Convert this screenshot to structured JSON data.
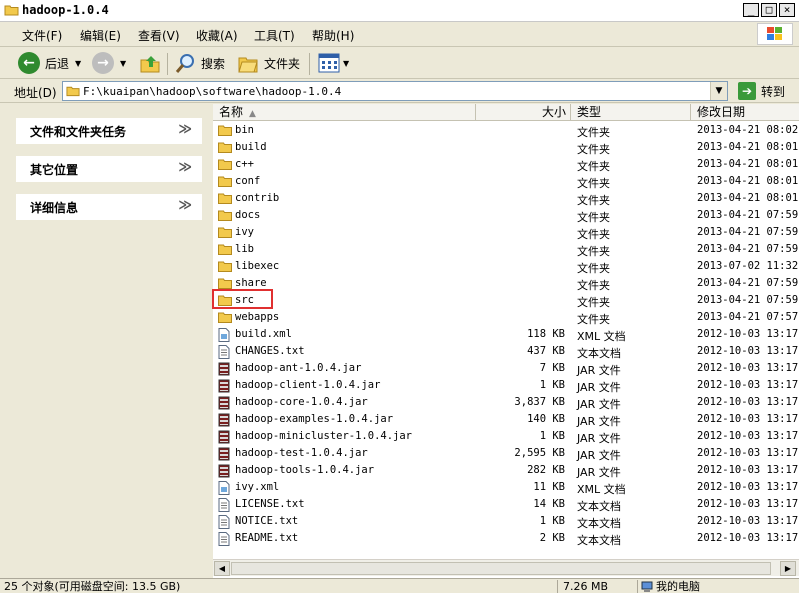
{
  "window": {
    "title": "hadoop-1.0.4",
    "buttons": [
      "_",
      "□",
      "×"
    ]
  },
  "menu": [
    "文件(F)",
    "编辑(E)",
    "查看(V)",
    "收藏(A)",
    "工具(T)",
    "帮助(H)"
  ],
  "toolbar": {
    "back_label": "后退",
    "search_label": "搜索",
    "folders_label": "文件夹"
  },
  "address": {
    "label": "地址(D)",
    "value": "F:\\kuaipan\\hadoop\\software\\hadoop-1.0.4",
    "go_label": "转到"
  },
  "tasks": [
    {
      "label": "文件和文件夹任务",
      "chevron": "≫"
    },
    {
      "label": "其它位置",
      "chevron": "≫"
    },
    {
      "label": "详细信息",
      "chevron": "≫"
    }
  ],
  "columns": {
    "name": "名称",
    "size": "大小",
    "type": "类型",
    "date": "修改日期"
  },
  "files": [
    {
      "name": "bin",
      "size": "",
      "type": "文件夹",
      "date": "2013-04-21 08:02",
      "kind": "folder"
    },
    {
      "name": "build",
      "size": "",
      "type": "文件夹",
      "date": "2013-04-21 08:01",
      "kind": "folder"
    },
    {
      "name": "c++",
      "size": "",
      "type": "文件夹",
      "date": "2013-04-21 08:01",
      "kind": "folder"
    },
    {
      "name": "conf",
      "size": "",
      "type": "文件夹",
      "date": "2013-04-21 08:01",
      "kind": "folder"
    },
    {
      "name": "contrib",
      "size": "",
      "type": "文件夹",
      "date": "2013-04-21 08:01",
      "kind": "folder"
    },
    {
      "name": "docs",
      "size": "",
      "type": "文件夹",
      "date": "2013-04-21 07:59",
      "kind": "folder"
    },
    {
      "name": "ivy",
      "size": "",
      "type": "文件夹",
      "date": "2013-04-21 07:59",
      "kind": "folder"
    },
    {
      "name": "lib",
      "size": "",
      "type": "文件夹",
      "date": "2013-04-21 07:59",
      "kind": "folder"
    },
    {
      "name": "libexec",
      "size": "",
      "type": "文件夹",
      "date": "2013-07-02 11:32",
      "kind": "folder"
    },
    {
      "name": "share",
      "size": "",
      "type": "文件夹",
      "date": "2013-04-21 07:59",
      "kind": "folder"
    },
    {
      "name": "src",
      "size": "",
      "type": "文件夹",
      "date": "2013-04-21 07:59",
      "kind": "folder",
      "highlighted": true
    },
    {
      "name": "webapps",
      "size": "",
      "type": "文件夹",
      "date": "2013-04-21 07:57",
      "kind": "folder"
    },
    {
      "name": "build.xml",
      "size": "118 KB",
      "type": "XML 文档",
      "date": "2012-10-03 13:17",
      "kind": "xml"
    },
    {
      "name": "CHANGES.txt",
      "size": "437 KB",
      "type": "文本文档",
      "date": "2012-10-03 13:17",
      "kind": "txt"
    },
    {
      "name": "hadoop-ant-1.0.4.jar",
      "size": "7 KB",
      "type": "JAR 文件",
      "date": "2012-10-03 13:17",
      "kind": "jar"
    },
    {
      "name": "hadoop-client-1.0.4.jar",
      "size": "1 KB",
      "type": "JAR 文件",
      "date": "2012-10-03 13:17",
      "kind": "jar"
    },
    {
      "name": "hadoop-core-1.0.4.jar",
      "size": "3,837 KB",
      "type": "JAR 文件",
      "date": "2012-10-03 13:17",
      "kind": "jar"
    },
    {
      "name": "hadoop-examples-1.0.4.jar",
      "size": "140 KB",
      "type": "JAR 文件",
      "date": "2012-10-03 13:17",
      "kind": "jar"
    },
    {
      "name": "hadoop-minicluster-1.0.4.jar",
      "size": "1 KB",
      "type": "JAR 文件",
      "date": "2012-10-03 13:17",
      "kind": "jar"
    },
    {
      "name": "hadoop-test-1.0.4.jar",
      "size": "2,595 KB",
      "type": "JAR 文件",
      "date": "2012-10-03 13:17",
      "kind": "jar"
    },
    {
      "name": "hadoop-tools-1.0.4.jar",
      "size": "282 KB",
      "type": "JAR 文件",
      "date": "2012-10-03 13:17",
      "kind": "jar"
    },
    {
      "name": "ivy.xml",
      "size": "11 KB",
      "type": "XML 文档",
      "date": "2012-10-03 13:17",
      "kind": "xml"
    },
    {
      "name": "LICENSE.txt",
      "size": "14 KB",
      "type": "文本文档",
      "date": "2012-10-03 13:17",
      "kind": "txt"
    },
    {
      "name": "NOTICE.txt",
      "size": "1 KB",
      "type": "文本文档",
      "date": "2012-10-03 13:17",
      "kind": "txt"
    },
    {
      "name": "README.txt",
      "size": "2 KB",
      "type": "文本文档",
      "date": "2012-10-03 13:17",
      "kind": "txt"
    }
  ],
  "status": {
    "objects": "25 个对象(可用磁盘空间: 13.5 GB)",
    "size": "7.26 MB",
    "location": "我的电脑"
  },
  "colors": {
    "folder": "#f2c94c",
    "highlight": "#e03030",
    "go": "#3a9a3a",
    "back": "#2f8a2f"
  }
}
